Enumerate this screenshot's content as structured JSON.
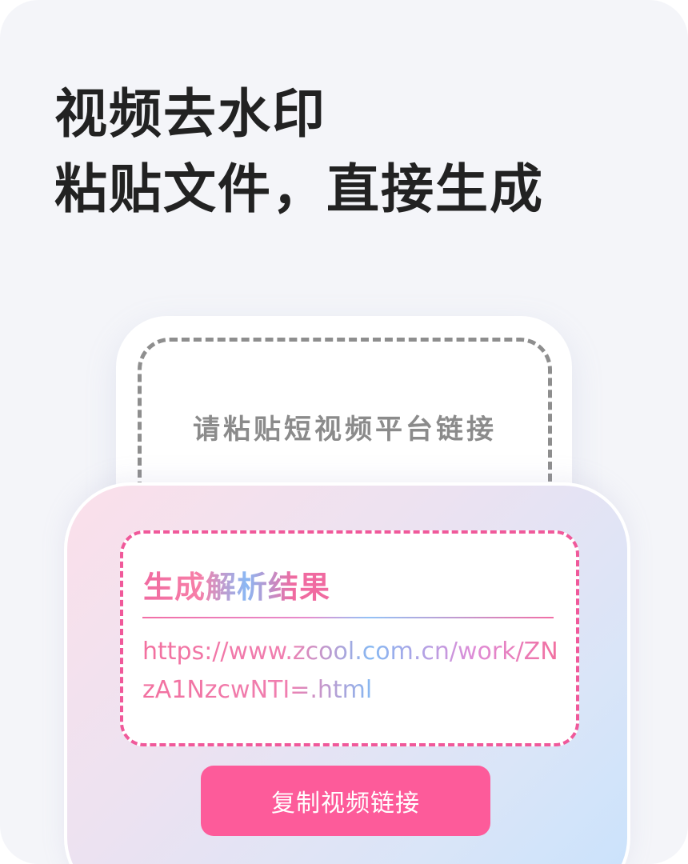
{
  "headline": {
    "line1": "视频去水印",
    "line2": "粘贴文件，直接生成"
  },
  "paste_card": {
    "placeholder": "请粘贴短视频平台链接"
  },
  "result": {
    "title": "生成解析结果",
    "url": "https://www.zcool.com.cn/work/ZNzA1NzcwNTI=.html",
    "copy_button_label": "复制视频链接"
  },
  "colors": {
    "accent": "#fd5b9a",
    "headline": "#222222",
    "placeholder": "#8b8b8b",
    "background": "#f4f5f9"
  }
}
